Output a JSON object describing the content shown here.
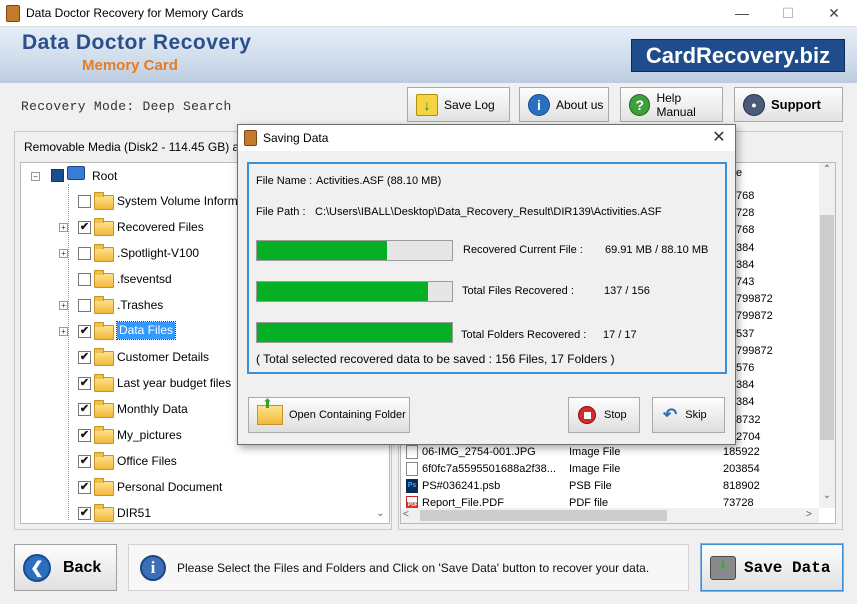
{
  "window": {
    "title": "Data Doctor Recovery for Memory Cards",
    "controls": {
      "minimize": "—",
      "maximize": "☐",
      "close": "✕"
    }
  },
  "banner": {
    "brand_line1": "Data Doctor Recovery",
    "brand_line2": "Memory Card",
    "site": "CardRecovery.biz"
  },
  "mode": "Recovery Mode: Deep Search",
  "toolbar": {
    "save_log": "Save Log",
    "about_us": "About us",
    "help_manual": "Help Manual",
    "support": "Support"
  },
  "left_panel": {
    "media_info": "Removable Media (Disk2 - 114.45 GB) as FAT",
    "root": "Root",
    "items": [
      {
        "label": "System Volume Informat",
        "checked": false,
        "expandable": false
      },
      {
        "label": "Recovered Files",
        "checked": true,
        "expandable": true
      },
      {
        "label": ".Spotlight-V100",
        "checked": false,
        "expandable": true
      },
      {
        "label": ".fseventsd",
        "checked": false,
        "expandable": false
      },
      {
        "label": ".Trashes",
        "checked": false,
        "expandable": true
      },
      {
        "label": "Data Files",
        "checked": true,
        "expandable": true,
        "selected": true
      },
      {
        "label": "Customer Details",
        "checked": true,
        "expandable": false
      },
      {
        "label": "Last year budget files",
        "checked": true,
        "expandable": false
      },
      {
        "label": "Monthly Data",
        "checked": true,
        "expandable": false
      },
      {
        "label": "My_pictures",
        "checked": true,
        "expandable": false
      },
      {
        "label": "Office Files",
        "checked": true,
        "expandable": false
      },
      {
        "label": "Personal Document",
        "checked": true,
        "expandable": false
      },
      {
        "label": "DIR51",
        "checked": true,
        "expandable": false
      }
    ]
  },
  "right_panel": {
    "column_header_fragment": "e",
    "size_fragments": [
      "768",
      "728",
      "768",
      "384",
      "384",
      "743",
      "799872",
      "799872",
      "537",
      "799872",
      "576",
      "384",
      "384",
      "8732",
      "2704"
    ],
    "rows": [
      {
        "name": "06-IMG_2754-001.JPG",
        "type": "Image File",
        "size": "185922",
        "icon": "image-file-icon"
      },
      {
        "name": "6f0fc7a5595501688a2f38...",
        "type": "Image File",
        "size": "203854",
        "icon": "image-file-icon"
      },
      {
        "name": "PS#036241.psb",
        "type": "PSB File",
        "size": "818902",
        "icon": "psb-file-icon"
      },
      {
        "name": "Report_File.PDF",
        "type": "PDF file",
        "size": "73728",
        "icon": "pdf-file-icon"
      }
    ]
  },
  "dialog": {
    "title": "Saving Data",
    "file_name_label": "File Name :",
    "file_name_value": "Activities.ASF (88.10 MB)",
    "file_path_label": "File Path :",
    "file_path_value": "C:\\Users\\IBALL\\Desktop\\Data_Recovery_Result\\DIR139\\Activities.ASF",
    "progress": [
      {
        "label": "Recovered Current File :",
        "value": "69.91 MB  /  88.10 MB",
        "fraction": 0.6656
      },
      {
        "label": "Total Files Recovered :",
        "value": "137 / 156",
        "fraction": 0.8782
      },
      {
        "label": "Total Folders Recovered :",
        "value": "17 / 17",
        "fraction": 1.0
      }
    ],
    "summary": "( Total selected recovered data to be saved : 156 Files, 17 Folders )",
    "open_folder": "Open Containing Folder",
    "stop": "Stop",
    "skip": "Skip"
  },
  "bottom": {
    "back": "Back",
    "info": "Please Select the Files and Folders and Click on 'Save Data' button to recover your data.",
    "save_data": "Save Data"
  },
  "colors": {
    "progress": "#06b025",
    "accent_blue": "#1f4d8c",
    "brand_orange": "#e87b1e",
    "selection": "#3399ff"
  }
}
